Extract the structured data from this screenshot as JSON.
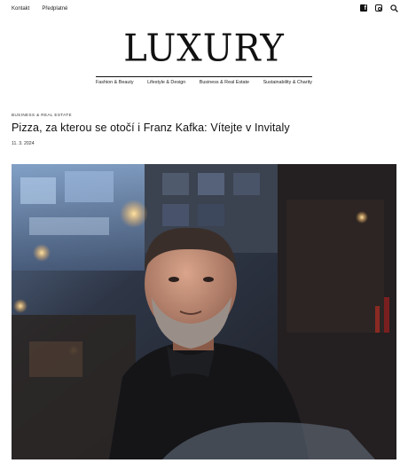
{
  "topnav": {
    "items": [
      {
        "label": "Kontakt"
      },
      {
        "label": "Předplatné"
      }
    ]
  },
  "social": {
    "icons": [
      "facebook-icon",
      "instagram-icon",
      "search-icon"
    ]
  },
  "brand": {
    "logo_text": "LUXURY"
  },
  "mainnav": {
    "items": [
      {
        "label": "Fashion & Beauty"
      },
      {
        "label": "Lifestyle & Design"
      },
      {
        "label": "Business & Real Estate"
      },
      {
        "label": "Sustainability & Charity"
      }
    ]
  },
  "article": {
    "category": "Business & Real Estate",
    "title": "Pizza, za kterou se otočí i Franz Kafka: Vítejte v Invitaly",
    "date": "11. 3. 2024"
  },
  "colors": {
    "text": "#111111",
    "background": "#ffffff"
  }
}
